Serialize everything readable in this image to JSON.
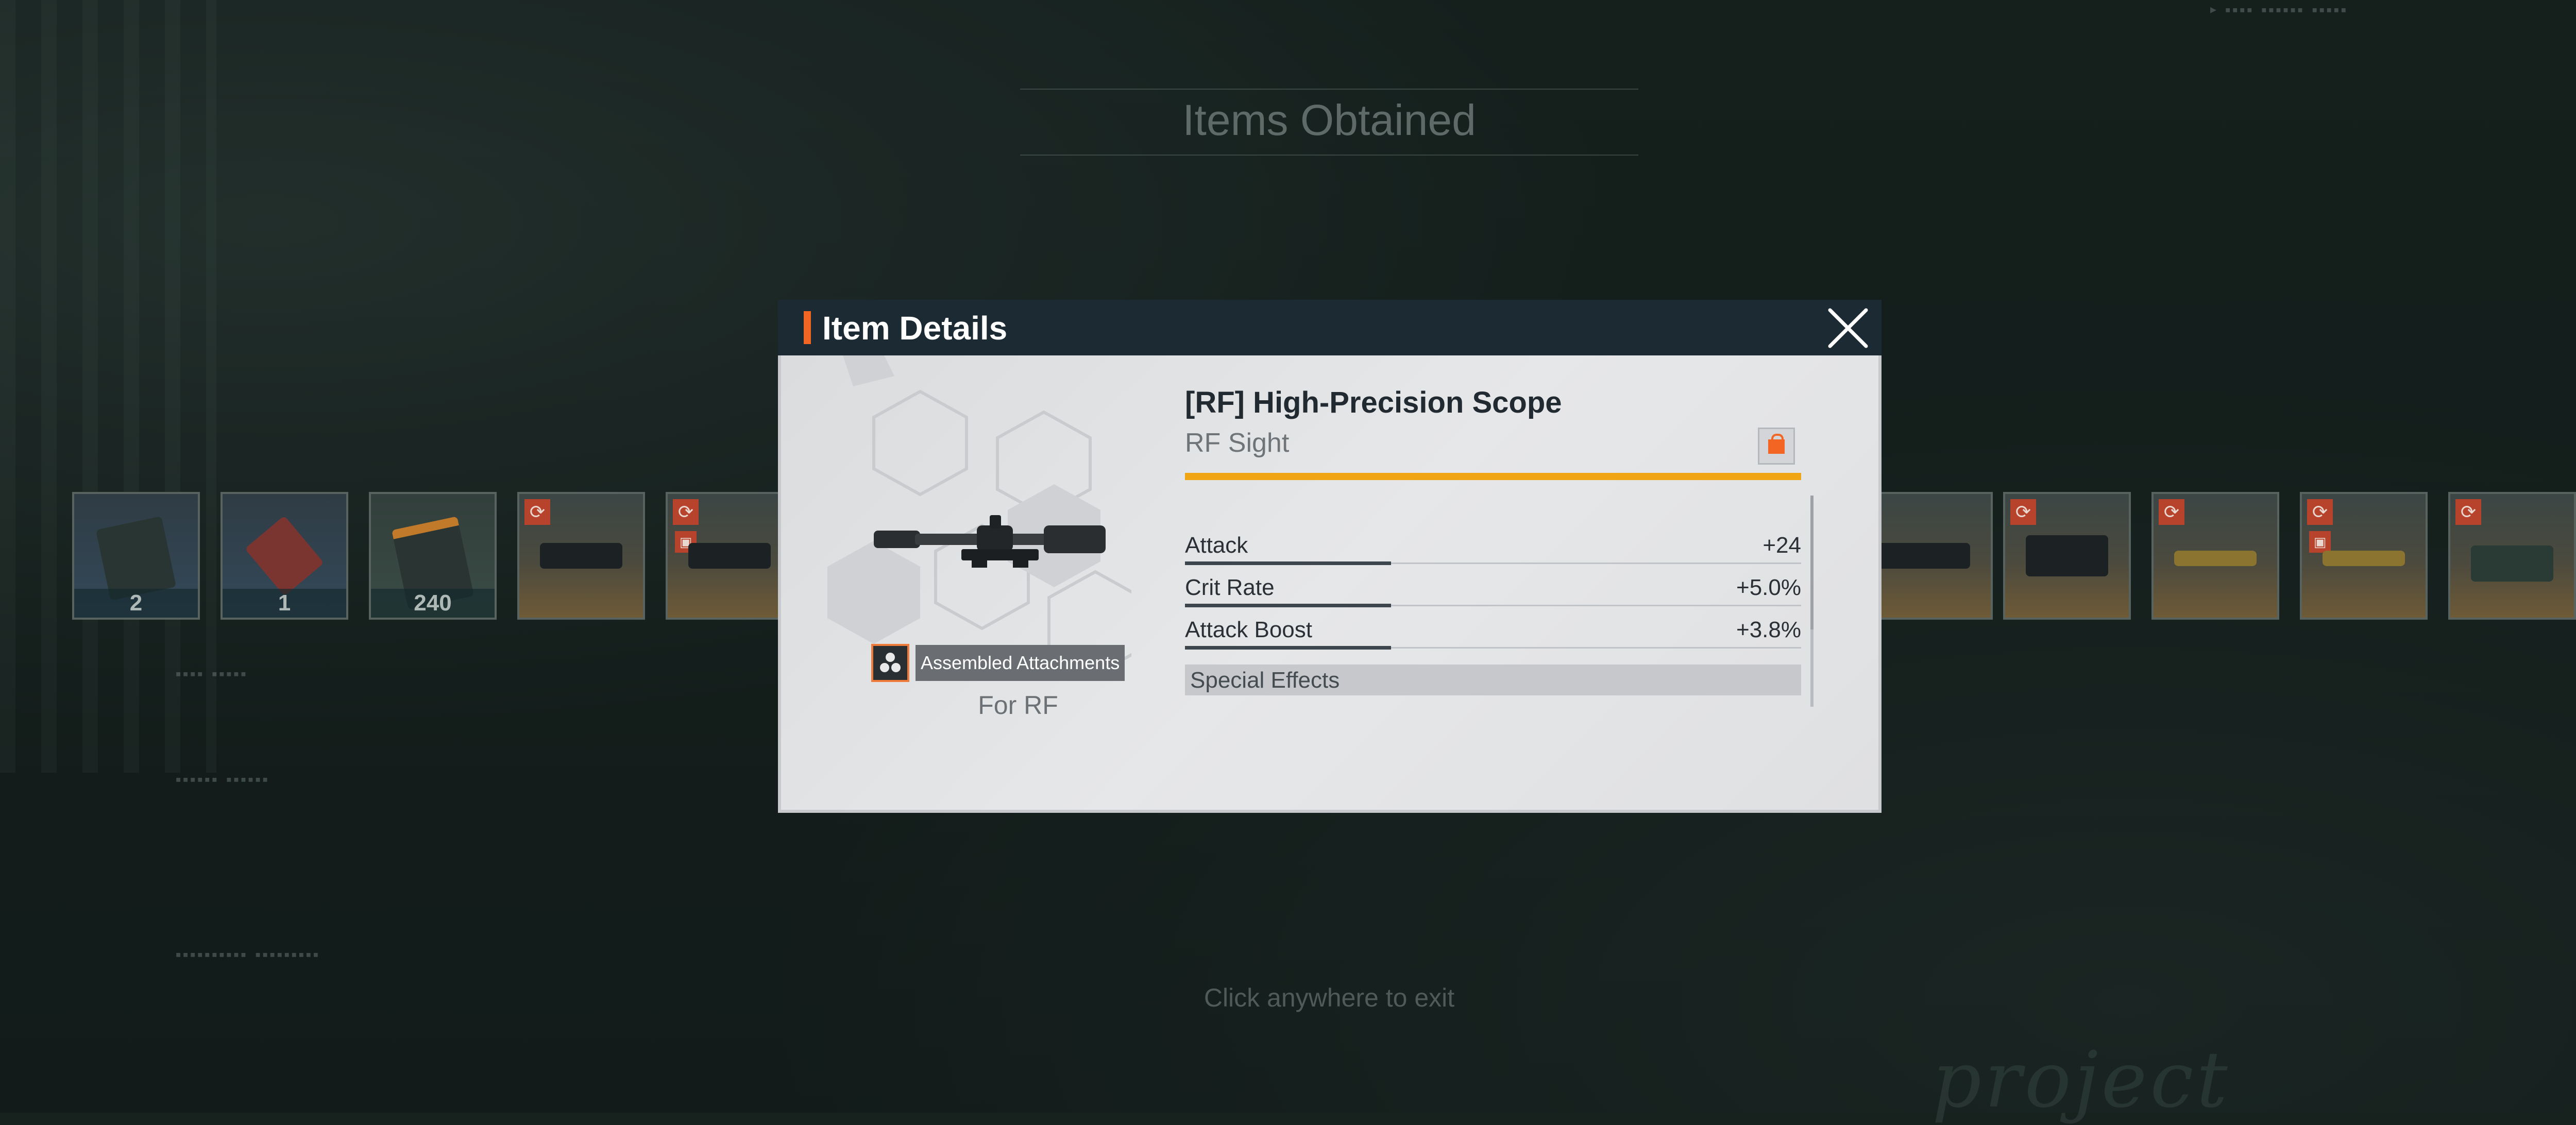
{
  "screen": {
    "title": "Items Obtained",
    "exit_hint": "Click anywhere to exit"
  },
  "rewards": [
    {
      "kind": "blue",
      "count": "2",
      "icon": "data-card-icon"
    },
    {
      "kind": "blue",
      "count": "1",
      "icon": "tool-icon"
    },
    {
      "kind": "green",
      "count": "240",
      "icon": "ammo-case-icon"
    },
    {
      "kind": "orange",
      "count": "",
      "icon": "scope-icon",
      "refresh": true,
      "locked": false
    },
    {
      "kind": "orange",
      "count": "",
      "icon": "scope-icon",
      "refresh": true,
      "locked": true
    },
    {
      "kind": "orange",
      "count": "",
      "icon": "rifle-part-icon",
      "refresh": false,
      "locked": false
    },
    {
      "kind": "orange",
      "count": "",
      "icon": "receiver-icon",
      "refresh": true,
      "locked": false
    },
    {
      "kind": "orange",
      "count": "",
      "icon": "barrel-icon",
      "refresh": true,
      "locked": false
    },
    {
      "kind": "orange",
      "count": "",
      "icon": "barrel-icon",
      "refresh": true,
      "locked": true
    },
    {
      "kind": "orange",
      "count": "",
      "icon": "magazine-icon",
      "refresh": true,
      "locked": false
    },
    {
      "kind": "orange",
      "count": "",
      "icon": "magazine-icon",
      "refresh": true,
      "locked": true
    }
  ],
  "modal": {
    "title": "Item Details",
    "item_name": "[RF] High-Precision Scope",
    "item_type": "RF Sight",
    "tag_label": "Assembled Attachments",
    "for_label": "For RF",
    "quality_color": "#f0a514",
    "accent_color": "#f26522",
    "stats": [
      {
        "name": "Attack",
        "value": "+24"
      },
      {
        "name": "Crit Rate",
        "value": "+5.0%"
      },
      {
        "name": "Attack Boost",
        "value": "+3.8%"
      }
    ],
    "special_effects_label": "Special Effects"
  }
}
